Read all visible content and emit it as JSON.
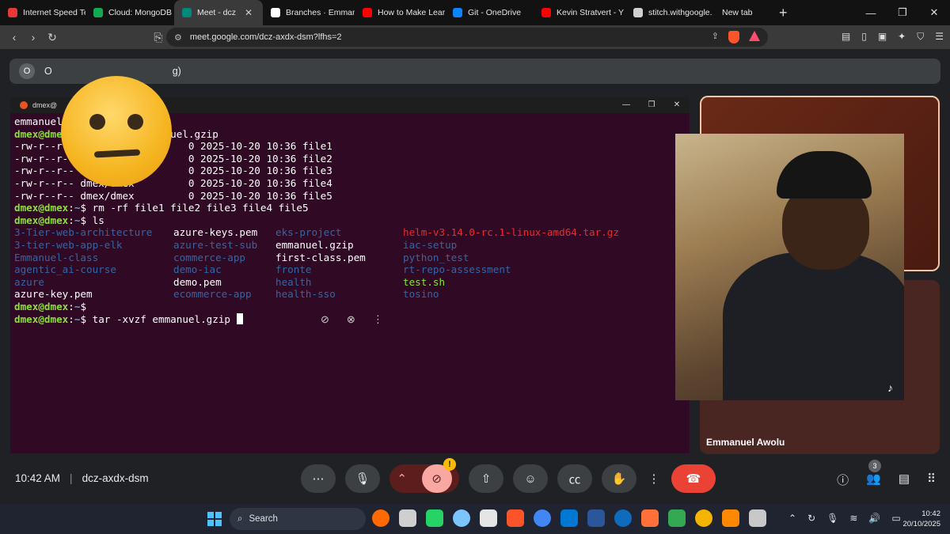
{
  "browser": {
    "tabs": [
      {
        "label": "Internet Speed Tes",
        "color": "#e53935"
      },
      {
        "label": "Cloud: MongoDB",
        "color": "#13aa52"
      },
      {
        "label": "Meet - dcz",
        "color": "#00897b",
        "active": true
      },
      {
        "label": "Branches · Emman",
        "color": "#ffffff"
      },
      {
        "label": "How to Make Lear",
        "color": "#ff0000"
      },
      {
        "label": "Git - OneDrive",
        "color": "#0a84ff"
      },
      {
        "label": "Kevin Stratvert - Y",
        "color": "#ff0000"
      },
      {
        "label": "stitch.withgoogle.",
        "color": "#cfcfcf"
      },
      {
        "label": "New tab",
        "color": ""
      }
    ],
    "new_tab_icon": "+",
    "url": "meet.google.com/dcz-axdx-dsm?lfhs=2"
  },
  "meet": {
    "presenter_avatar": "O",
    "presenter_text_prefix": "O",
    "presenter_text_suffix": "g)",
    "meeting_time": "10:42 AM",
    "meeting_code": "dcz-axdx-dsm",
    "participant_count": "3",
    "participant_name": "Emmanuel Awolu",
    "camera_warning": "!",
    "tiktok_mark": "♪"
  },
  "terminal": {
    "title": "dmex@",
    "prompt_user": "dmex@dmex",
    "prompt_path": "~",
    "lines_before": [
      {
        "type": "text",
        "text": "emmanuel"
      },
      {
        "type": "prompt",
        "cmd": "tar -cf emmanuel.gzip"
      },
      {
        "type": "text",
        "text": "-rw-r--r-- dmex/dmex         0 2025-10-20 10:36 file1"
      },
      {
        "type": "text",
        "text": "-rw-r--r-- dmex/dmex         0 2025-10-20 10:36 file2"
      },
      {
        "type": "text",
        "text": "-rw-r--r-- dmex/dmex         0 2025-10-20 10:36 file3"
      },
      {
        "type": "text",
        "text": "-rw-r--r-- dmex/dmex         0 2025-10-20 10:36 file4"
      },
      {
        "type": "text",
        "text": "-rw-r--r-- dmex/dmex         0 2025-10-20 10:36 file5"
      },
      {
        "type": "prompt",
        "cmd": "rm -rf file1 file2 file3 file4 file5"
      },
      {
        "type": "prompt",
        "cmd": "ls"
      }
    ],
    "ls_entries": [
      {
        "name": "3-Tier-web-architecture",
        "kind": "dir"
      },
      {
        "name": "azure-keys.pem",
        "kind": "file"
      },
      {
        "name": "eks-project",
        "kind": "dir"
      },
      {
        "name": "helm-v3.14.0-rc.1-linux-amd64.tar.gz",
        "kind": "arch"
      },
      {
        "name": "3-tier-web-app-elk",
        "kind": "dir"
      },
      {
        "name": "azure-test-sub",
        "kind": "dir"
      },
      {
        "name": "emmanuel.gzip",
        "kind": "file"
      },
      {
        "name": "iac-setup",
        "kind": "dir"
      },
      {
        "name": "Emmanuel-class",
        "kind": "dir"
      },
      {
        "name": "commerce-app",
        "kind": "dir"
      },
      {
        "name": "first-class.pem",
        "kind": "file"
      },
      {
        "name": "python_test",
        "kind": "dir"
      },
      {
        "name": "agentic_ai-course",
        "kind": "dir"
      },
      {
        "name": "demo-iac",
        "kind": "dir"
      },
      {
        "name": "fronte",
        "kind": "dir"
      },
      {
        "name": "rt-repo-assessment",
        "kind": "dir"
      },
      {
        "name": "azure",
        "kind": "dir"
      },
      {
        "name": "demo.pem",
        "kind": "file"
      },
      {
        "name": "health",
        "kind": "dir"
      },
      {
        "name": "test.sh",
        "kind": "exec"
      },
      {
        "name": "azure-key.pem",
        "kind": "file"
      },
      {
        "name": "ecommerce-app",
        "kind": "dir"
      },
      {
        "name": "health-sso",
        "kind": "dir"
      },
      {
        "name": "tosino",
        "kind": "dir"
      }
    ],
    "lines_after": [
      {
        "type": "prompt",
        "cmd": ""
      },
      {
        "type": "prompt",
        "cmd": "tar -xvzf emmanuel.gzip ",
        "cursor": true
      }
    ],
    "colors": {
      "user": "#8ae234",
      "path": "#729fcf",
      "dir": "#3465a4",
      "arch": "#ef2929",
      "exec": "#8ae234",
      "bg": "#300a24"
    }
  },
  "taskbar": {
    "search_label": "Search",
    "time": "10:42",
    "date": "20/10/2025",
    "apps": [
      "#ff6a00",
      "#cfcfcf",
      "#25d366",
      "#7cc4ff",
      "#e5e5e5",
      "#fb542b",
      "#4285f4",
      "#0078d4",
      "#2b579a",
      "#0f6cbd",
      "#ff7139",
      "#34a853",
      "#f5b400",
      "#ff8800",
      "#c8c8c8"
    ]
  }
}
